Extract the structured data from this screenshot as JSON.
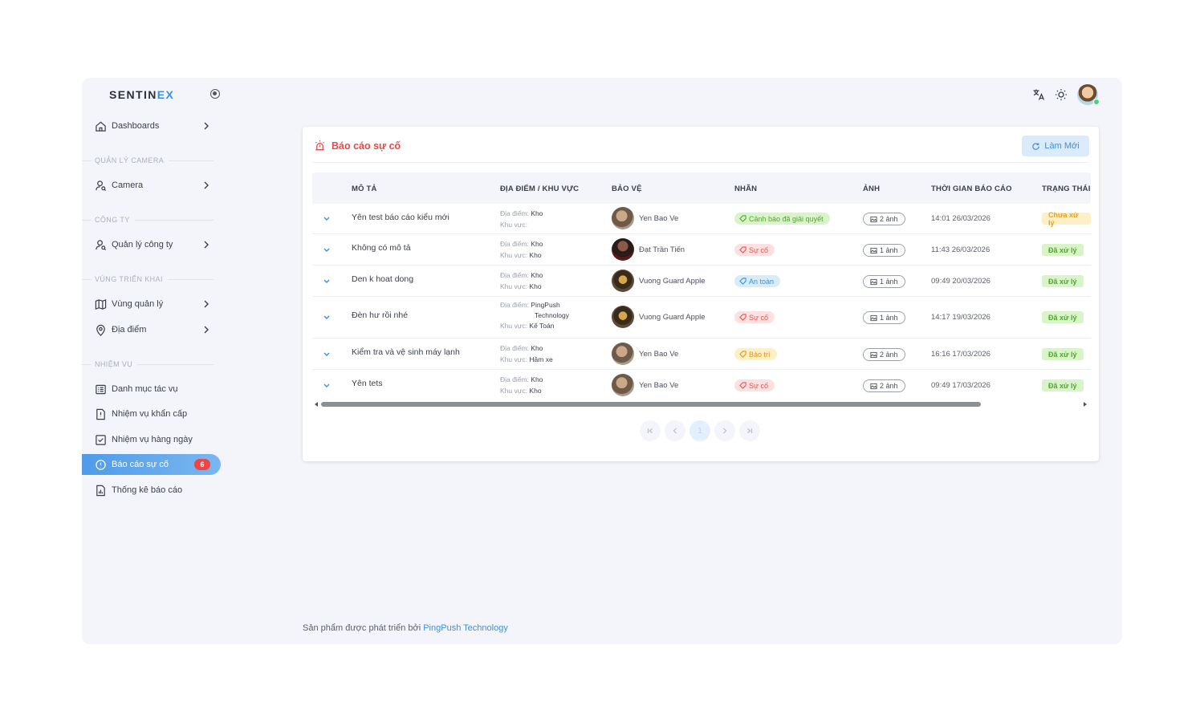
{
  "brand": {
    "name_main": "SENTIN",
    "name_accent": "EX"
  },
  "sidebar": {
    "items": [
      {
        "label": "Dashboards",
        "icon": "home-icon"
      },
      {
        "label": "Camera",
        "icon": "user-search-icon"
      },
      {
        "label": "Quản lý công ty",
        "icon": "user-search-icon"
      },
      {
        "label": "Vùng quản lý",
        "icon": "map-icon"
      },
      {
        "label": "Địa điểm",
        "icon": "map-pin-icon"
      },
      {
        "label": "Danh mục tác vụ",
        "icon": "list-icon"
      },
      {
        "label": "Nhiệm vụ khẩn cấp",
        "icon": "urgent-task-icon"
      },
      {
        "label": "Nhiệm vụ hàng ngày",
        "icon": "checkbox-icon"
      },
      {
        "label": "Báo cáo sự cố",
        "icon": "alert-circle-icon",
        "badge": "6"
      },
      {
        "label": "Thống kê báo cáo",
        "icon": "chart-report-icon"
      }
    ],
    "sections": [
      "QUẢN LÝ CAMERA",
      "CÔNG TY",
      "VÙNG TRIỂN KHAI",
      "NHIỆM VỤ"
    ]
  },
  "card": {
    "title": "Báo cáo sự cố",
    "refresh_label": "Làm Mới"
  },
  "table": {
    "headers": [
      "MÔ TẢ",
      "ĐỊA ĐIỂM / KHU VỰC",
      "BẢO VỆ",
      "NHÃN",
      "ẢNH",
      "THỜI GIAN BÁO CÁO",
      "TRẠNG THÁI"
    ],
    "loc_key": "Địa điểm:",
    "area_key": "Khu vực:",
    "rows": [
      {
        "desc": "Yên test báo cáo kiểu mới",
        "location": "Kho",
        "area": "",
        "guard": "Yen Bao Ve",
        "tag": "Cảnh báo đã giải quyết",
        "images": "2 ảnh",
        "time": "14:01 26/03/2026",
        "status": "Chưa xử lý"
      },
      {
        "desc": "Không có mô tả",
        "location": "Kho",
        "area": "Kho",
        "guard": "Đạt Trần Tiến",
        "tag": "Sự cố",
        "images": "1 ảnh",
        "time": "11:43 26/03/2026",
        "status": "Đã xử lý"
      },
      {
        "desc": "Den k hoat dong",
        "location": "Kho",
        "area": "Kho",
        "guard": "Vuong Guard Apple",
        "tag": "An toàn",
        "images": "1 ảnh",
        "time": "09:49 20/03/2026",
        "status": "Đã xử lý"
      },
      {
        "desc": "Đèn hư rồi nhé",
        "location": "PingPush",
        "location2": "Technology",
        "area": "Kế Toán",
        "guard": "Vuong Guard Apple",
        "tag": "Sự cố",
        "images": "1 ảnh",
        "time": "14:17 19/03/2026",
        "status": "Đã xử lý"
      },
      {
        "desc": "Kiểm tra và vệ sinh máy lạnh",
        "location": "Kho",
        "area": "Hầm xe",
        "guard": "Yen Bao Ve",
        "tag": "Bảo trì",
        "images": "2 ảnh",
        "time": "16:16 17/03/2026",
        "status": "Đã xử lý"
      },
      {
        "desc": "Yên tets",
        "location": "Kho",
        "area": "Kho",
        "guard": "Yen Bao Ve",
        "tag": "Sự cố",
        "images": "2 ảnh",
        "time": "09:49 17/03/2026",
        "status": "Đã xử lý"
      }
    ]
  },
  "pagination": {
    "current_page": "1"
  },
  "footer": {
    "text": "Sản phẩm được phát triển bởi",
    "link": "PingPush Technology"
  },
  "colors": {
    "accent": "#3b8ee6",
    "danger": "#e54b4b",
    "success": "#4fa82a",
    "warning": "#e5a21a"
  }
}
